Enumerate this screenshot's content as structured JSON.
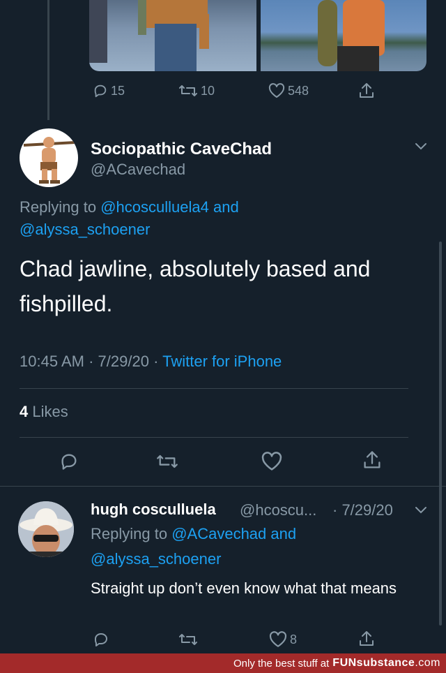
{
  "prev_tweet": {
    "replies": "15",
    "retweets": "10",
    "likes": "548"
  },
  "main_tweet": {
    "display_name": "Sociopathic CaveChad",
    "handle": "@ACavechad",
    "replying_prefix": "Replying to",
    "reply_to_1": "@hcosculluela4",
    "and_word": "and",
    "reply_to_2": "@alyssa_schoener",
    "text": "Chad jawline, absolutely based and fishpilled.",
    "time": "10:45 AM",
    "date": "7/29/20",
    "source": "Twitter for iPhone",
    "likes_count": "4",
    "likes_label": "Likes"
  },
  "reply_tweet": {
    "display_name": "hugh cosculluela",
    "handle": "@hcoscu...",
    "date": "· 7/29/20",
    "replying_prefix": "Replying to",
    "reply_to_1": "@ACavechad",
    "and_word": "and",
    "reply_to_2": "@alyssa_schoener",
    "text": "Straight up don’t even know what that means",
    "likes": "8"
  },
  "footer": {
    "tagline": "Only the best stuff at",
    "brand_bold": "FUNsubstance",
    "brand_suffix": ".com"
  },
  "colors": {
    "background": "#15202b",
    "accent": "#1da1f2",
    "muted": "#8899a6",
    "footer_bg": "#a32a2a"
  }
}
